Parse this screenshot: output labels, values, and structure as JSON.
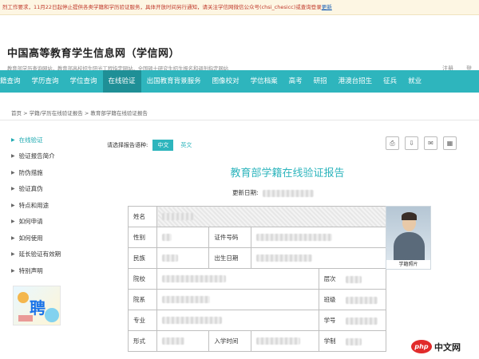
{
  "notice": {
    "text": "烈工作要求，11月22日起停止提供各类学籍和学历验证服务，具体开放时间另行通知，请关注学信网微信公众号(chsi_chesicc)或查询登录",
    "link": "更新"
  },
  "header": {
    "site_title": "中国高等教育学生信息网（学信网）",
    "subtitle": "教育部学历查询网站，教育部高校招生阳光工程指定网站，全国硕士研究生招生报名和调剂指定网站",
    "login": "注册",
    "login2": "登"
  },
  "nav": {
    "items": [
      {
        "label": "籍查询",
        "active": false
      },
      {
        "label": "学历查询",
        "active": false
      },
      {
        "label": "学位查询",
        "active": false
      },
      {
        "label": "在线验证",
        "active": true
      },
      {
        "label": "出国教育背景服务",
        "active": false
      },
      {
        "label": "图像校对",
        "active": false
      },
      {
        "label": "学信档案",
        "active": false
      },
      {
        "label": "高考",
        "active": false
      },
      {
        "label": "研招",
        "active": false
      },
      {
        "label": "港澳台招生",
        "active": false
      },
      {
        "label": "征兵",
        "active": false
      },
      {
        "label": "就业",
        "active": false
      }
    ]
  },
  "breadcrumb": "首页 > 学籍/学历在线验证报告 > 教育部学籍在线验证报告",
  "sidebar": {
    "items": [
      {
        "label": "在线验证",
        "active": true
      },
      {
        "label": "验证报告简介",
        "active": false
      },
      {
        "label": "防伪措施",
        "active": false
      },
      {
        "label": "验证真伪",
        "active": false
      },
      {
        "label": "特点和用途",
        "active": false
      },
      {
        "label": "如何申请",
        "active": false
      },
      {
        "label": "如何使用",
        "active": false
      },
      {
        "label": "延长验证有效期",
        "active": false
      },
      {
        "label": "特别声明",
        "active": false
      }
    ]
  },
  "ad": {
    "text": "聘"
  },
  "content": {
    "lang_label": "请选择报告语种:",
    "lang_cn": "中文",
    "lang_en": "英文",
    "report_title": "教育部学籍在线验证报告",
    "update_label": "更新日期:"
  },
  "tools": {
    "print": "⎙",
    "download": "⇩",
    "mail": "✉",
    "qrcode": "▦"
  },
  "table": {
    "name": "姓名",
    "gender": "性别",
    "id_type": "证件号码",
    "ethnicity": "民族",
    "birth": "出生日期",
    "school": "院校",
    "level": "层次",
    "department": "院系",
    "class": "班级",
    "major": "专业",
    "student_id": "学号",
    "form": "形式",
    "admission": "入学时间",
    "duration": "学制"
  },
  "photo_label": "学籍照片",
  "watermark": {
    "logo": "php",
    "text": "中文网"
  }
}
